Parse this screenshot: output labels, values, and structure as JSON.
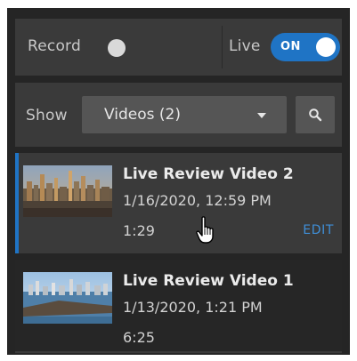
{
  "record": {
    "label": "Record",
    "state": "off"
  },
  "live": {
    "label": "Live",
    "toggle_text": "ON",
    "state": "on"
  },
  "show": {
    "label": "Show",
    "selected": "Videos (2)"
  },
  "icons": {
    "search": "search-icon",
    "caret": "chevron-down-icon",
    "cursor": "hand-pointer-icon"
  },
  "colors": {
    "accent": "#1f74c5",
    "panel": "#3a3a3a",
    "background": "#252525",
    "edit_link": "#3f8fd8"
  },
  "videos": [
    {
      "title": "Live Review Video 2",
      "date": "1/16/2020, 12:59 PM",
      "duration": "1:29",
      "action": "EDIT",
      "selected": true
    },
    {
      "title": "Live Review Video 1",
      "date": "1/13/2020, 1:21 PM",
      "duration": "6:25",
      "selected": false
    }
  ]
}
